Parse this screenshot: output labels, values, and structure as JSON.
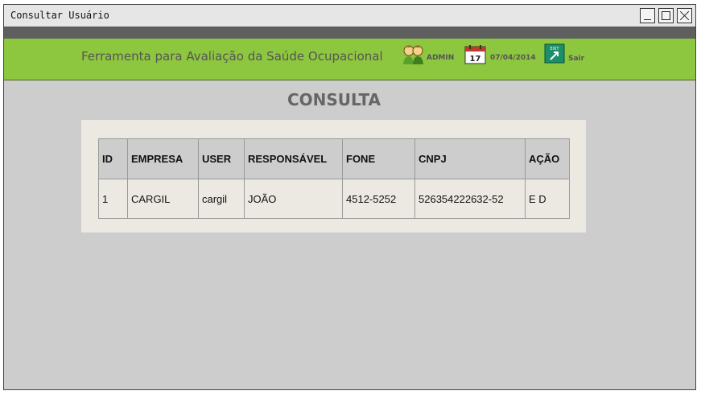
{
  "window": {
    "title": "Consultar Usuário"
  },
  "header": {
    "title": "Ferramenta para Avaliação da Saúde Ocupacional",
    "user": "ADMIN",
    "date": "07/04/2014",
    "exit_icon_text": "EXIT",
    "exit_label": "Sair",
    "calendar_day": "17",
    "accent_color": "#8dc63f"
  },
  "main": {
    "title": "CONSULTA",
    "table": {
      "columns": [
        "ID",
        "EMPRESA",
        "USER",
        "RESPONSÁVEL",
        "FONE",
        "CNPJ",
        "AÇÃO"
      ],
      "rows": [
        [
          "1",
          "CARGIL",
          "cargil",
          "JOÃO",
          "4512-5252",
          "526354222632-52",
          "E D"
        ]
      ]
    }
  }
}
